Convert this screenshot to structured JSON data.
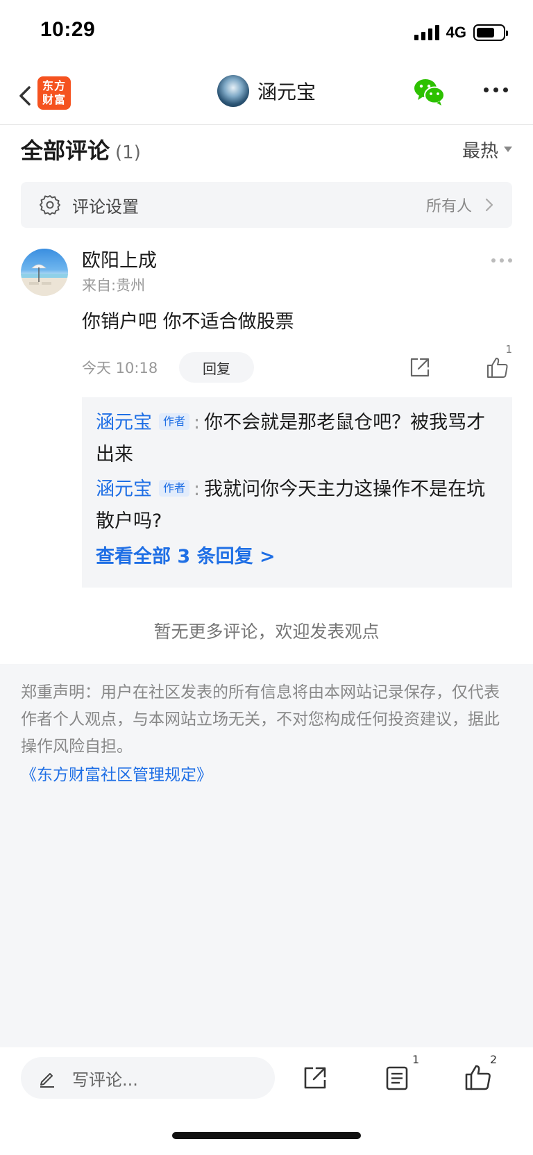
{
  "status_bar": {
    "time": "10:29",
    "network": "4G"
  },
  "nav": {
    "logo_line1": "东方",
    "logo_line2": "财富",
    "title": "涵元宝",
    "icons": [
      "back-icon",
      "wechat-icon",
      "more-icon"
    ]
  },
  "comments_header": {
    "title": "全部评论",
    "count": "(1)",
    "sort_label": "最热"
  },
  "settings": {
    "label": "评论设置",
    "value": "所有人"
  },
  "comment": {
    "username": "欧阳上成",
    "location": "来自:贵州",
    "text": "你销户吧 你不适合做股票",
    "time": "今天 10:18",
    "reply_label": "回复",
    "like_count": "1",
    "replies": [
      {
        "user": "涵元宝",
        "tag": "作者",
        "colon": ":",
        "text": "你不会就是那老鼠仓吧？被我骂才出来"
      },
      {
        "user": "涵元宝",
        "tag": "作者",
        "colon": ":",
        "text": "我就问你今天主力这操作不是在坑散户吗?"
      }
    ],
    "view_all": "查看全部 3 条回复 >"
  },
  "no_more": "暂无更多评论，欢迎发表观点",
  "disclaimer": {
    "text": "郑重声明：用户在社区发表的所有信息将由本网站记录保存，仅代表作者个人观点，与本网站立场无关，不对您构成任何投资建议，据此操作风险自担。",
    "link": "《东方财富社区管理规定》"
  },
  "bottom_bar": {
    "input_placeholder": "写评论...",
    "list_count": "1",
    "like_count": "2"
  },
  "colors": {
    "accent": "#1f6fe5",
    "brand": "#f5521f",
    "wechat": "#2dc100"
  }
}
